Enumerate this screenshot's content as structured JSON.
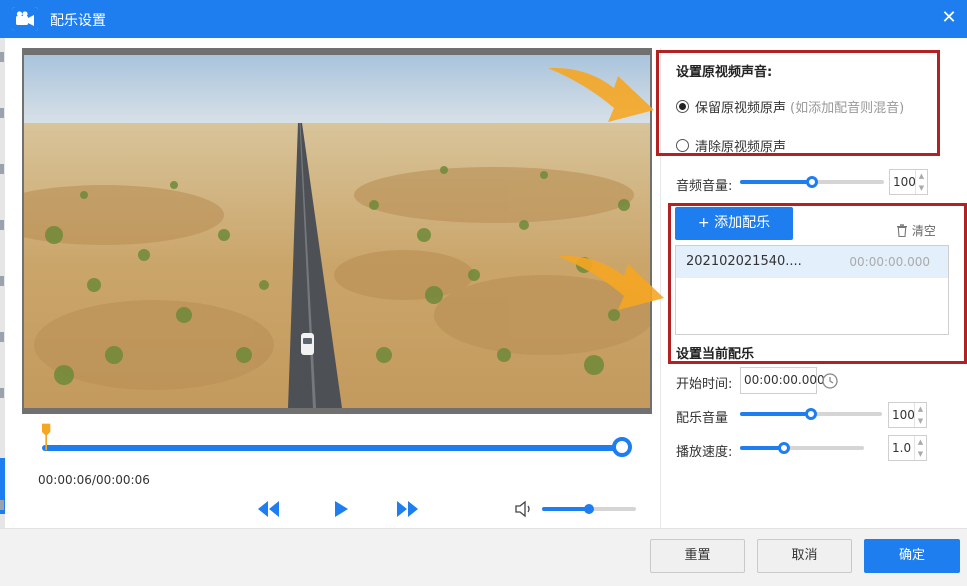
{
  "window": {
    "title": "配乐设置",
    "close_symbol": "✕"
  },
  "player": {
    "timecode": "00:00:06/00:00:06",
    "progress": 1.0,
    "volume": 0.5
  },
  "original_audio": {
    "heading": "设置原视频声音:",
    "options": [
      {
        "label": "保留原视频原声",
        "hint": "(如添加配音则混音)",
        "checked": true
      },
      {
        "label": "清除原视频原声",
        "checked": false
      }
    ]
  },
  "audio_volume": {
    "label": "音频音量:",
    "value": "100",
    "level": 1.0
  },
  "music": {
    "add_label": "+ 添加配乐",
    "clear_label": "清空",
    "items": [
      {
        "name": "202102021540....",
        "duration": "00:00:00.000"
      }
    ]
  },
  "current_music": {
    "heading": "设置当前配乐",
    "start_label": "开始时间:",
    "start_value": "00:00:00.000",
    "volume_label": "配乐音量",
    "volume_value": "100",
    "speed_label": "播放速度:",
    "speed_value": "1.0"
  },
  "footer": {
    "reset": "重置",
    "cancel": "取消",
    "ok": "确定"
  },
  "colors": {
    "accent": "#1e7ef0",
    "highlight": "#b22222",
    "arrow": "#f5a623"
  },
  "icons": [
    "video-camera-icon",
    "close-icon",
    "rewind-icon",
    "play-icon",
    "fast-forward-icon",
    "volume-icon",
    "trash-icon",
    "clock-icon",
    "arrow-pointer-icon"
  ]
}
